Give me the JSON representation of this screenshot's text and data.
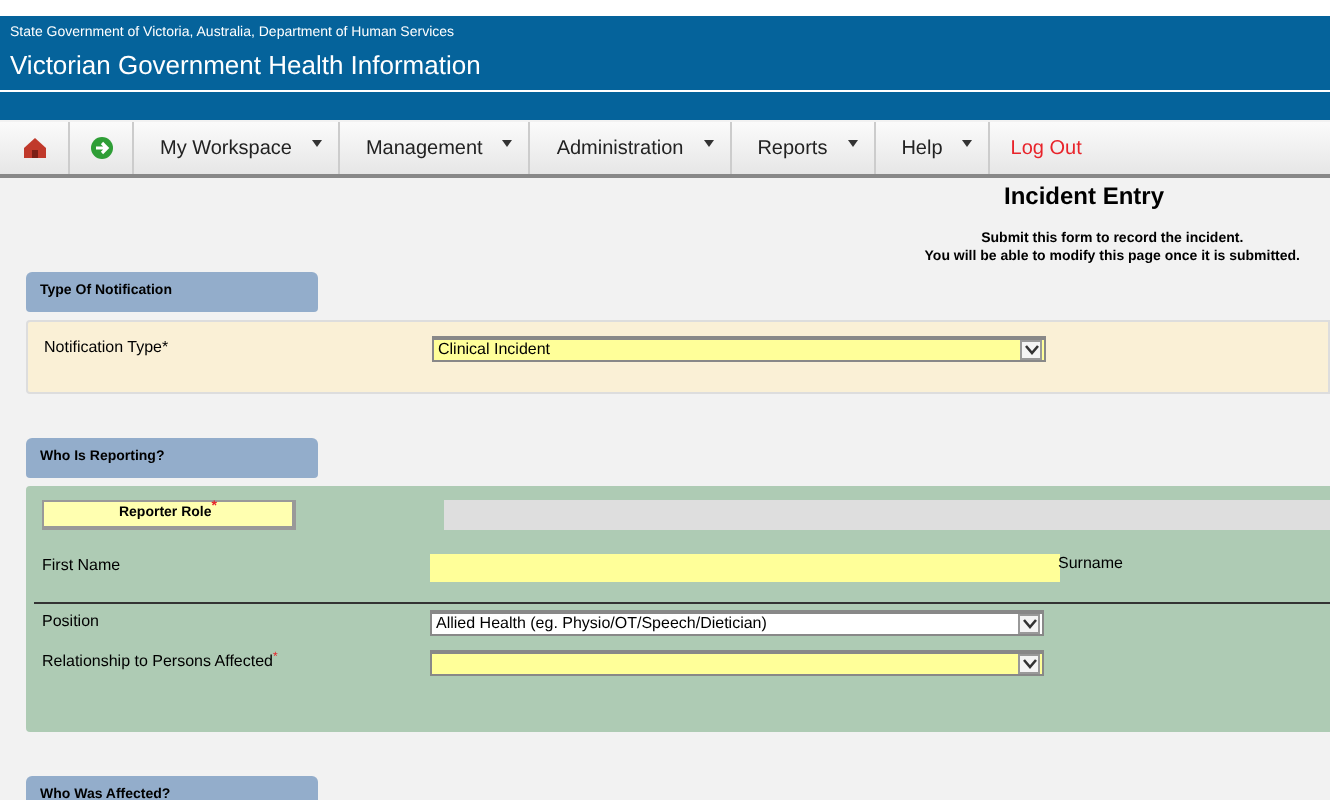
{
  "header": {
    "agency": "State Government of Victoria, Australia, Department of Human Services",
    "title": "Victorian Government Health Information"
  },
  "menu": [
    {
      "label": "My Workspace",
      "kind": "dropdown"
    },
    {
      "label": "Management",
      "kind": "dropdown"
    },
    {
      "label": "Administration",
      "kind": "dropdown"
    },
    {
      "label": "Reports",
      "kind": "dropdown"
    },
    {
      "label": "Help",
      "kind": "dropdown"
    },
    {
      "label": "Log Out",
      "kind": "link"
    }
  ],
  "page": {
    "title": "Incident Entry",
    "notes": [
      "Submit this form to record the incident.",
      "You will be able to modify this page once it is submitted."
    ]
  },
  "sections": [
    {
      "title": "Type Of Notification",
      "kind": "notification",
      "fields": [
        {
          "kind": "select",
          "label": "Notification Type*",
          "value": "Clinical Incident",
          "highlighted": true
        }
      ]
    },
    {
      "title": "Who Is Reporting?",
      "kind": "reporting",
      "fields": [
        {
          "kind": "button",
          "label": "Reporter Role",
          "required_mark": "*"
        },
        {
          "kind": "text",
          "label": "First Name",
          "highlighted": true,
          "trailing_label": "Surname"
        },
        {
          "kind": "divider"
        },
        {
          "kind": "select",
          "label": "Position",
          "value": "Allied Health (eg. Physio/OT/Speech/Dietician)",
          "highlighted": false
        },
        {
          "kind": "select",
          "label": "Relationship to Persons Affected",
          "required_mark": "*",
          "highlighted": true
        }
      ]
    },
    {
      "title": "Who Was Affected?",
      "kind": "collapsed"
    }
  ]
}
